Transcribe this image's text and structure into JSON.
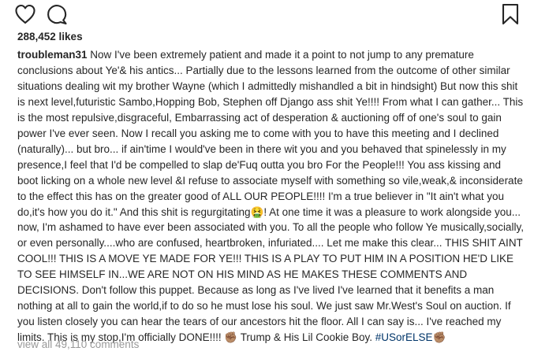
{
  "post": {
    "actions": {
      "like_icon": "heart-outline-icon",
      "comment_icon": "speech-bubble-icon",
      "save_icon": "bookmark-icon"
    },
    "likes_text": "288,452 likes",
    "caption": {
      "username": "troubleman31",
      "body_part1": "Now I've been extremely patient and made it a point to not jump to any premature conclusions about Ye'& his antics... Partially due to the lessons learned from the outcome of other similar situations dealing wit my brother Wayne (which I admittedly mishandled a bit in hindsight) But now this shit is next level,futuristic Sambo,Hopping Bob, Stephen off Django ass shit Ye!!!! From what I can gather... This is the most repulsive,disgraceful, Embarrassing act of desperation & auctioning off of one's soul to gain power I've ever seen. Now I recall you asking me to come with you to have this meeting and I declined (naturally)... but bro... if ain'time I would've been in there wit you and you behaved that spinelessly in my presence,I feel that I'd be compelled to slap de'Fuq outta you bro For the People!!! You ass kissing and boot licking on a whole new level &I refuse to associate myself with something so vile,weak,& inconsiderate to the effect this has on the greater good of ALL OUR PEOPLE!!!! I'm a true believer in \"It ain't what you do,it's how you do it.\" And this shit is regurgitating🤮!",
      "body_part2": "At one time it was a pleasure to work alongside you... now, I'm ashamed to have ever been associated with you. To all the people who follow Ye musically,socially, or even personally....who are confused, heartbroken, infuriated.... Let me make this clear... THIS SHIT AINT COOL!!! THIS IS A MOVE YE MADE FOR YE!!! THIS IS A PLAY TO PUT HIM IN A POSITION HE'D LIKE TO SEE HIMSELF IN...WE ARE NOT ON HIS MIND AS HE MAKES THESE COMMENTS AND DECISIONS. Don't follow this puppet. Because as long as I've lived I've learned that it benefits a man nothing at all to gain the world,if to do so he must lose his soul. We just saw Mr.West's Soul on auction. If you listen closely you can hear the tears of our ancestors hit the floor. All I can say is... I've reached my limits. This is my stop,I'm officially DONE!!!! ✊🏽 Trump & His Lil Cookie Boy.",
      "hashtag": "#USorELSE",
      "hashtag_emoji": "✊🏽"
    },
    "view_comments_text": "view all 49,110 comments"
  }
}
